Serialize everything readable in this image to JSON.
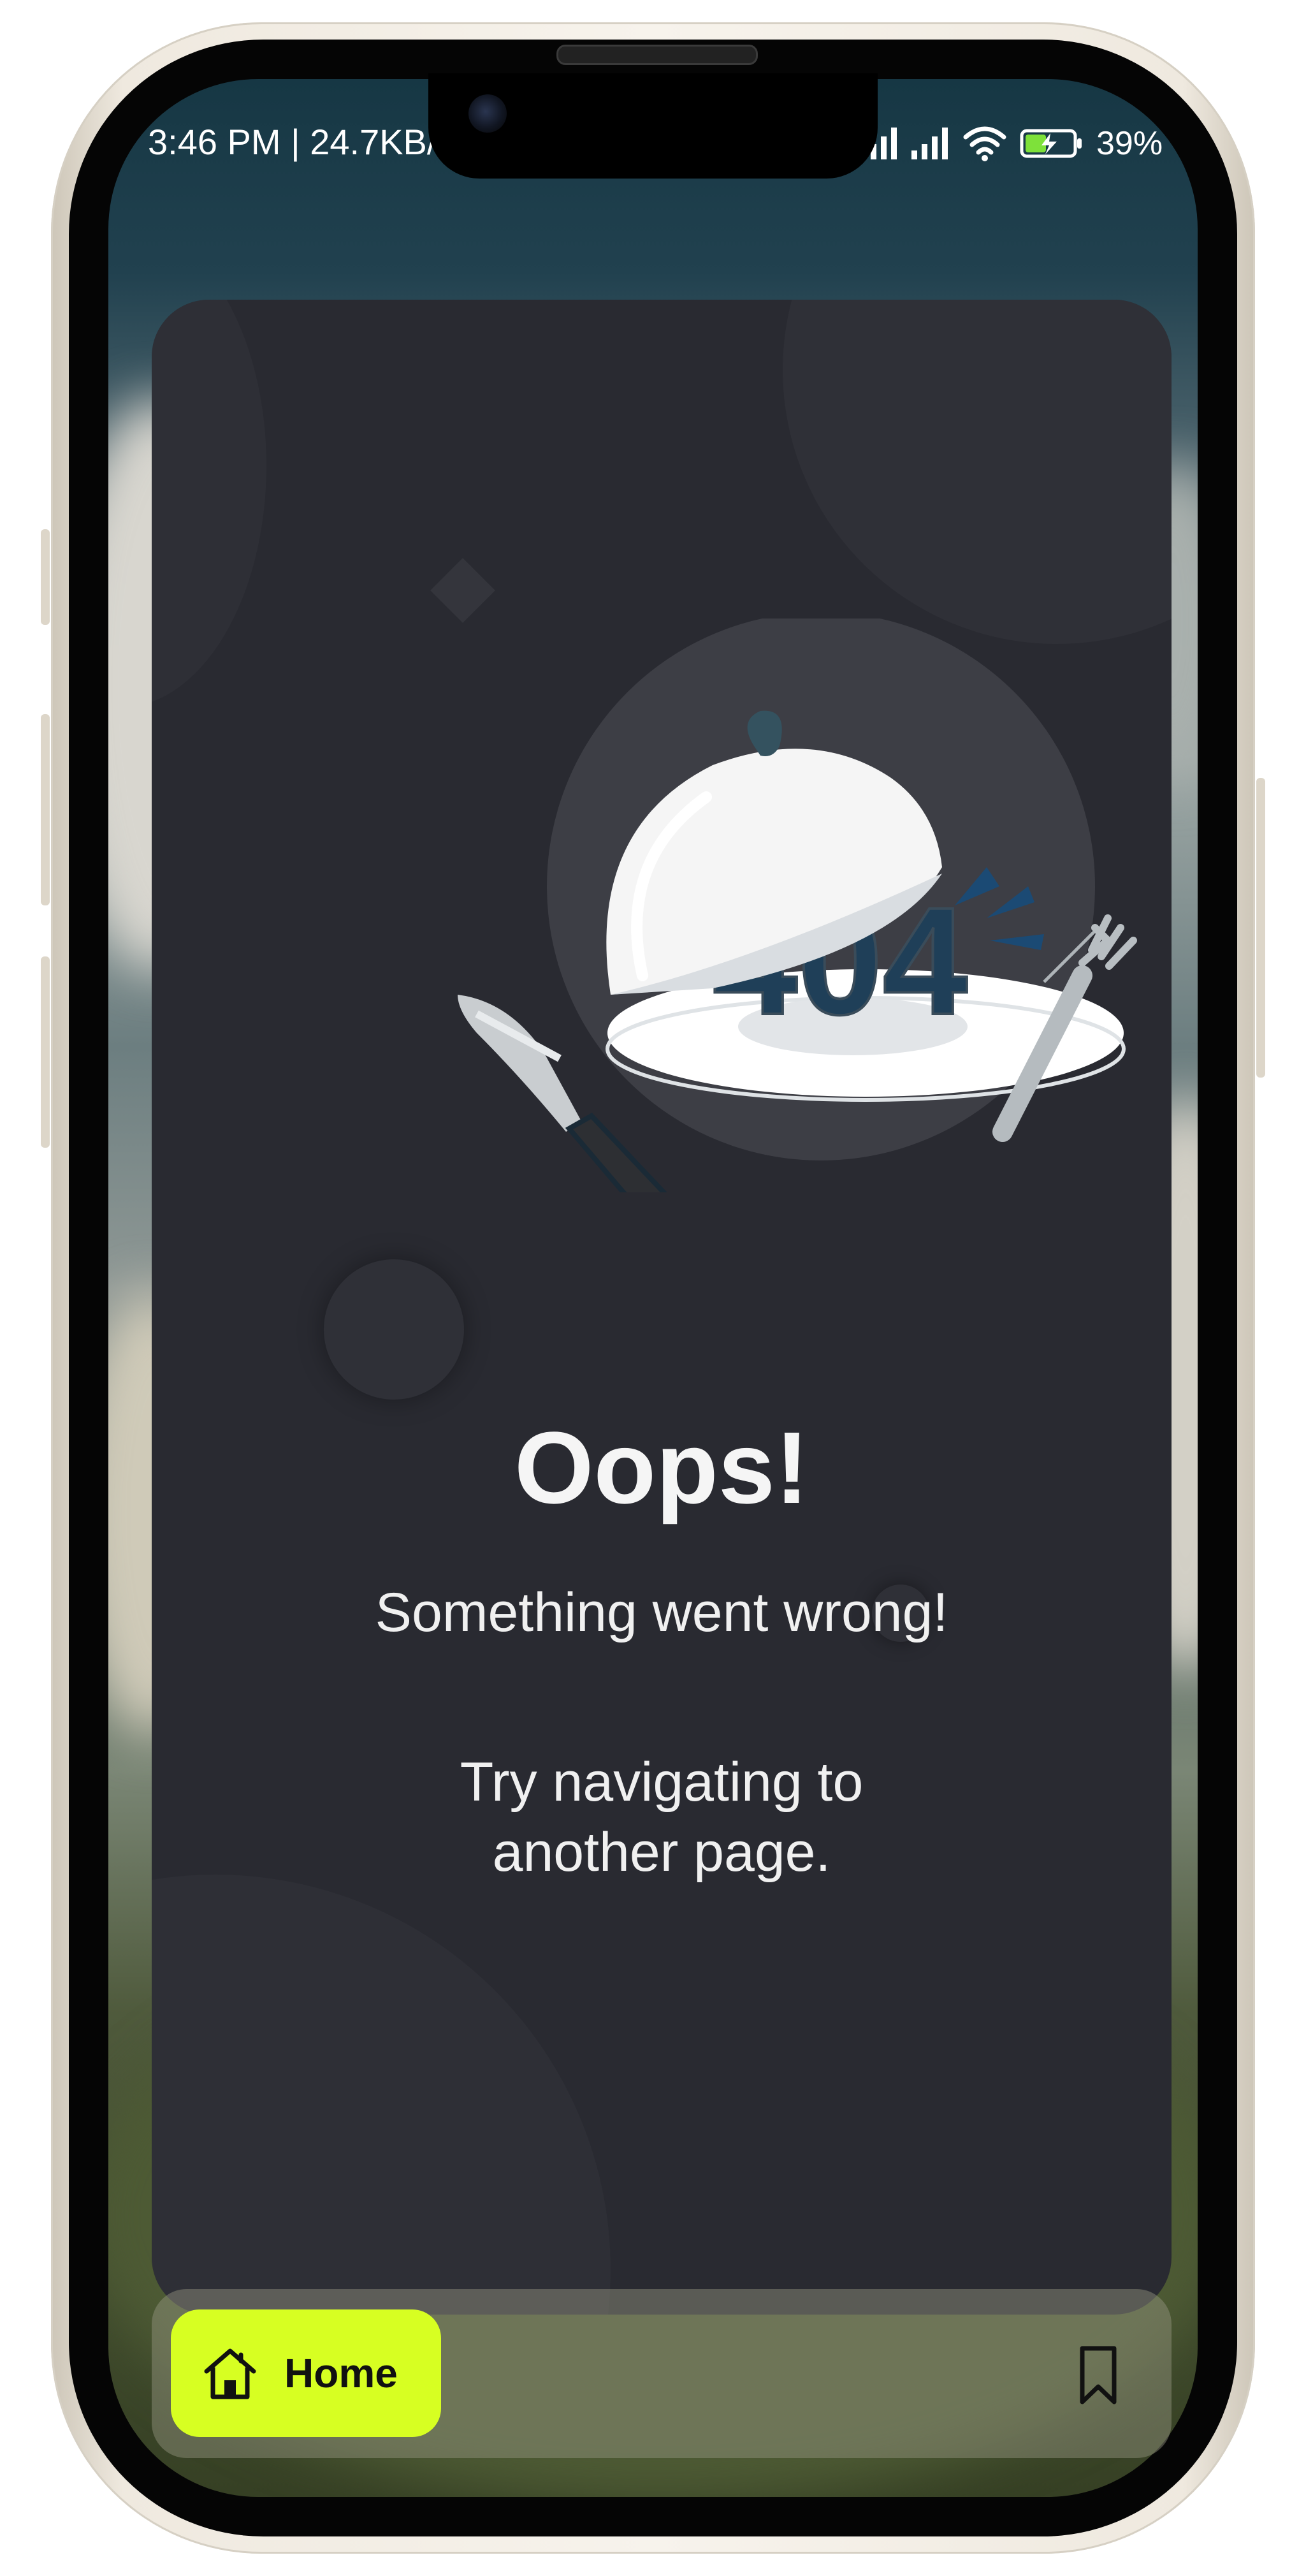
{
  "status_bar": {
    "left_text": "3:46 PM | 24.7KB/",
    "battery_text": "39%",
    "icons": [
      "signal-icon",
      "signal-icon",
      "wifi-icon",
      "battery-charging-icon"
    ]
  },
  "illustration": {
    "error_code": "404",
    "icon": "cloche-404-illustration"
  },
  "message": {
    "title": "Oops!",
    "subtitle": "Something went wrong!",
    "hint_line1": "Try navigating to",
    "hint_line2": "another page."
  },
  "bottom_nav": {
    "home_label": "Home",
    "home_icon": "home-icon",
    "bookmark_icon": "bookmark-icon"
  },
  "colors": {
    "accent": "#d7ff22",
    "card_background": "#292a31",
    "text": "#f5f5f5",
    "error_code": "#1f3f58"
  }
}
